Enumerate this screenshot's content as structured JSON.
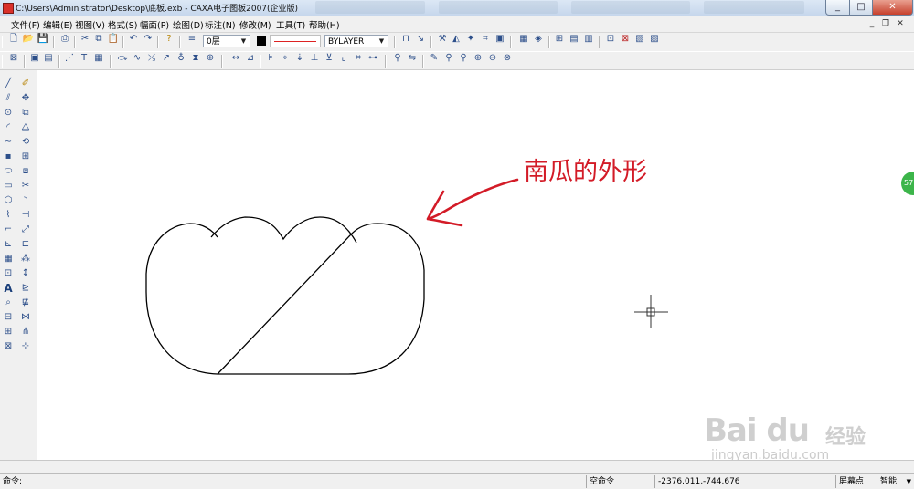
{
  "window": {
    "title": "C:\\Users\\Administrator\\Desktop\\底板.exb - CAXA电子图板2007(企业版)",
    "minimize_glyph": "_",
    "maximize_glyph": "□",
    "close_glyph": "✕"
  },
  "menu": {
    "items": [
      "文件(F)",
      "编辑(E)",
      "视图(V)",
      "格式(S)",
      "幅面(P)",
      "绘图(D)",
      "标注(N)",
      "修改(M)",
      "工具(T)",
      "帮助(H)"
    ],
    "mdi_minimize": "_",
    "mdi_restore": "❐",
    "mdi_close": "✕"
  },
  "properties": {
    "layer": "0层",
    "color_value": "#000000",
    "linetype_color": "#dd2222",
    "lineweight": "BYLAYER"
  },
  "drawing": {
    "annotation_text": "南瓜的外形",
    "annotation_color": "#d31b27",
    "shape_stroke": "#000000"
  },
  "status": {
    "command_label": "命令:",
    "command_state": "空命令",
    "coordinates": "-2376.011,-744.676",
    "snap_mode": "屏幕点",
    "smart_mode": "智能"
  },
  "watermark": {
    "logo": "Bai du",
    "brand_cn": "经验",
    "url": "jingyan.baidu.com"
  },
  "side_badge": "57"
}
